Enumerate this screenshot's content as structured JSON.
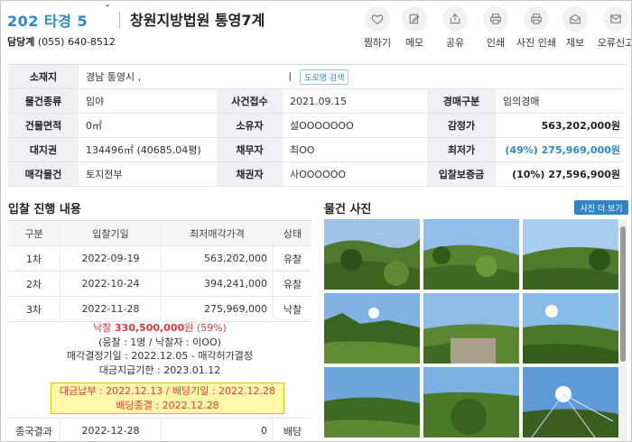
{
  "header": {
    "case_no": "202  타경 5",
    "tick": "ˇ",
    "court": "창원지방법원 통영7계",
    "contact_label": "담당계",
    "contact_phone": "(055) 640-8512",
    "actions": [
      {
        "label": "찜하기",
        "icon": "heart-icon"
      },
      {
        "label": "메모",
        "icon": "memo-icon"
      },
      {
        "label": "공유",
        "icon": "share-icon"
      },
      {
        "label": "인쇄",
        "icon": "print-icon"
      },
      {
        "label": "사진 인쇄",
        "icon": "photo-print-icon"
      },
      {
        "label": "제보",
        "icon": "report-icon"
      },
      {
        "label": "오류신고",
        "icon": "error-report-icon"
      }
    ]
  },
  "info": {
    "address_label": "소재지",
    "address_value": "경남 통영시 ,",
    "address_tail": "ㅣ",
    "road_button": "도로명 검색",
    "rows": [
      {
        "l1": "물건종류",
        "v1": "임야",
        "l2": "사건접수",
        "v2": "2021.09.15",
        "l3": "경매구분",
        "v3": "임의경매"
      },
      {
        "l1": "건물면적",
        "v1": "0㎡",
        "l2": "소유자",
        "v2": "설OOOOOOO",
        "l3": "감정가",
        "v3": "563,202,000원"
      },
      {
        "l1": "대지권",
        "v1": "134496㎡ (40685.04평)",
        "l2": "채무자",
        "v2": "최OO",
        "l3": "최저가",
        "v3": "(49%) 275,969,000원"
      },
      {
        "l1": "매각물건",
        "v1": "토지전부",
        "l2": "채권자",
        "v2": "사OOOOOO",
        "l3": "입찰보증금",
        "v3": "(10%) 27,596,900원"
      }
    ]
  },
  "bid_section": {
    "title": "입찰 진행 내용",
    "headers": [
      "구분",
      "입찰기일",
      "최저매각가격",
      "상태"
    ],
    "rows": [
      {
        "round": "1차",
        "date": "2022-09-19",
        "price": "563,202,000",
        "status": "유찰"
      },
      {
        "round": "2차",
        "date": "2022-10-24",
        "price": "394,241,000",
        "status": "유찰"
      },
      {
        "round": "3차",
        "date": "2022-11-28",
        "price": "275,969,000",
        "status": "낙찰"
      }
    ],
    "result": {
      "sold_prefix": "낙찰 ",
      "sold_price": "330,500,000",
      "sold_unit": "원 (",
      "sold_pct": "59%",
      "sold_close": ")",
      "bidders": "(응찰 : 1명 / 낙찰자 : 이OO)",
      "decision": "매각결정기일 : 2022.12.05 - 매각허가결정",
      "deadline": "대금지급기한 : 2023.01.12",
      "paid": "대금납부 : 2022.12.13 / 배당기일 : 2022.12.28",
      "dividend_done": "배당종결 : 2022.12.28"
    },
    "final": {
      "label": "종국결과",
      "date": "2022-12-28",
      "price": "0",
      "status": "배당"
    }
  },
  "photo_section": {
    "title": "물건 사진",
    "more_button": "사진 더 보기"
  },
  "colors": {
    "accent_blue": "#2e86c9",
    "sold_red": "#e0393b",
    "highlight_yellow": "#fff7a8"
  }
}
